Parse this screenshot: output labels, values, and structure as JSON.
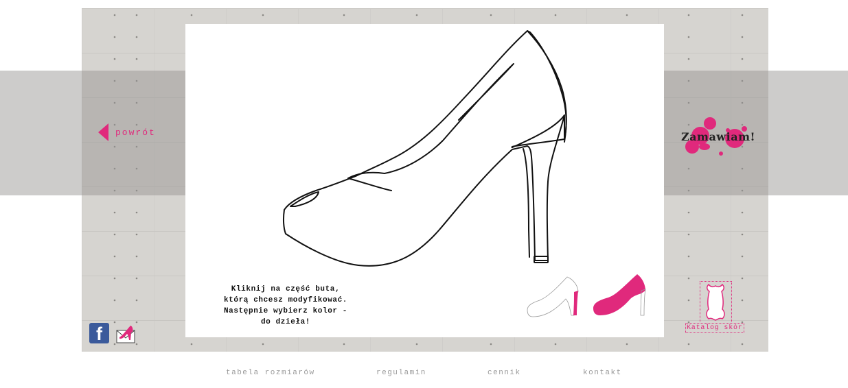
{
  "nav": {
    "back_label": "powrót",
    "order_label": "Zamawiam!"
  },
  "instruction": {
    "lines": [
      "Kliknij na część buta,",
      "którą chcesz modyfikować.",
      "Następnie wybierz kolor -",
      "do dzieła!"
    ]
  },
  "catalog": {
    "label": "Katalog skór",
    "icon": "leather-hide-icon"
  },
  "social": {
    "facebook_icon": "facebook-icon",
    "facebook_glyph": "f",
    "mail_icon": "mail-shoe-icon"
  },
  "footer": {
    "links": [
      "tabela rozmiarów",
      "regulamin",
      "cennik",
      "kontakt"
    ]
  },
  "colors": {
    "accent": "#e0297c",
    "wall": "#d6d4d0",
    "band": "#a09f9c",
    "outline": "#111111"
  }
}
